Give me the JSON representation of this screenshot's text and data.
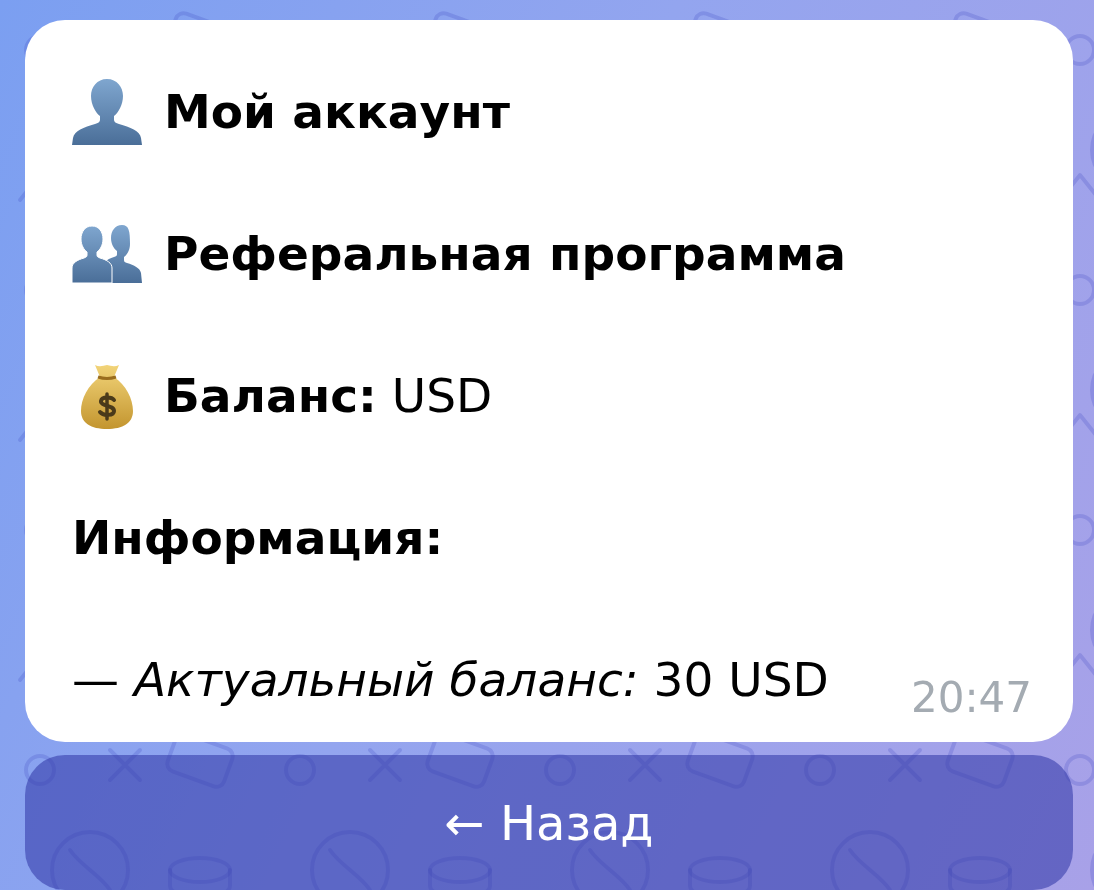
{
  "message": {
    "menu_lines": [
      {
        "kind": "bold",
        "text": "Мой аккаунт"
      },
      {
        "kind": "bold",
        "text": "Реферальная программа"
      },
      {
        "kind": "plain",
        "text": "**Баланс:** USD"
      }
    ],
    "heading": "Информация:",
    "detail": "— *Актуальный баланс:* 30 USD",
    "time": "20:47"
  },
  "keyboard": {
    "buttons": [
      "← Назад"
    ]
  }
}
